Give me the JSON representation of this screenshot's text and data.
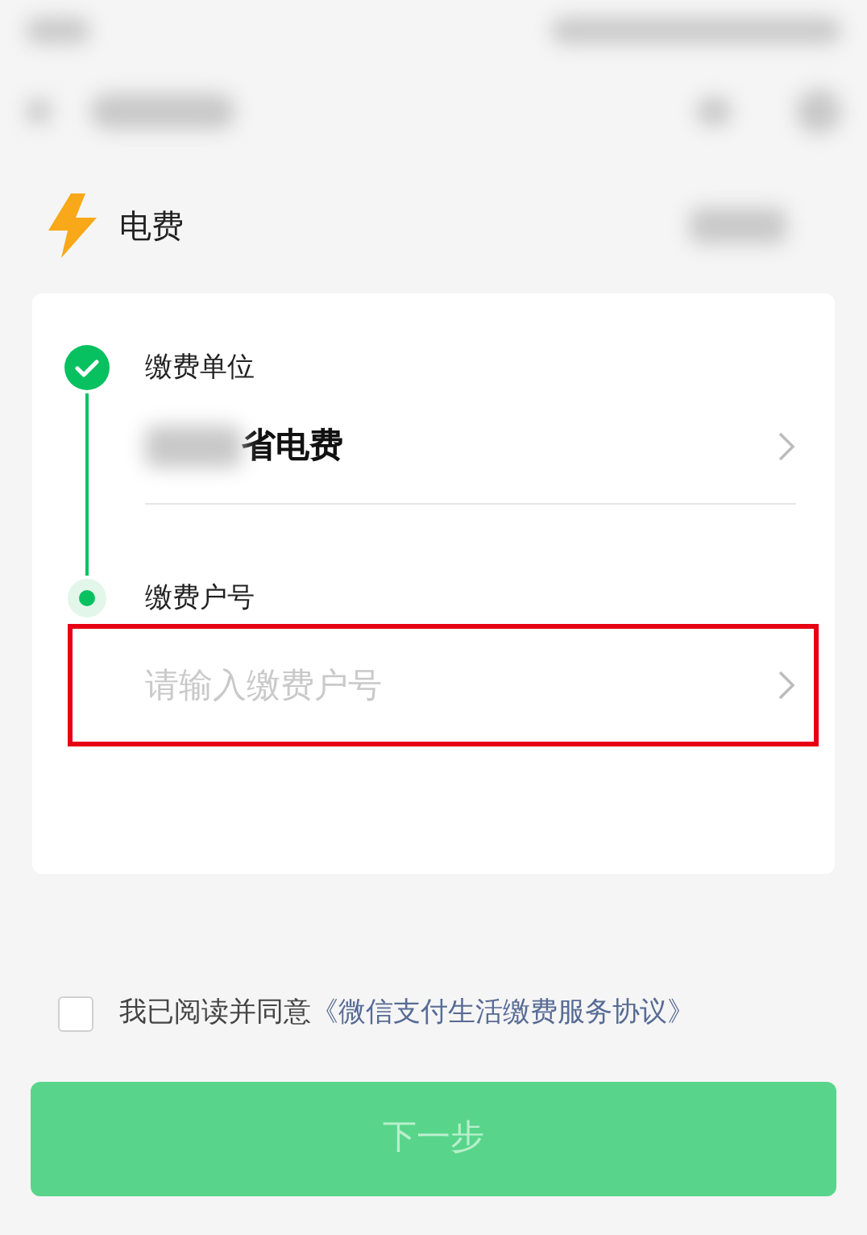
{
  "service": {
    "title": "电费"
  },
  "steps": [
    {
      "label": "缴费单位",
      "done": true,
      "kind": "select",
      "value": "省电费",
      "value_partly_redacted": true
    },
    {
      "label": "缴费户号",
      "done": false,
      "kind": "input",
      "placeholder": "请输入缴费户号",
      "highlighted": true
    }
  ],
  "agreement": {
    "checked": false,
    "text": "我已阅读并同意",
    "link": "《微信支付生活缴费服务协议》"
  },
  "next_button": {
    "label": "下一步",
    "disabled": true
  }
}
